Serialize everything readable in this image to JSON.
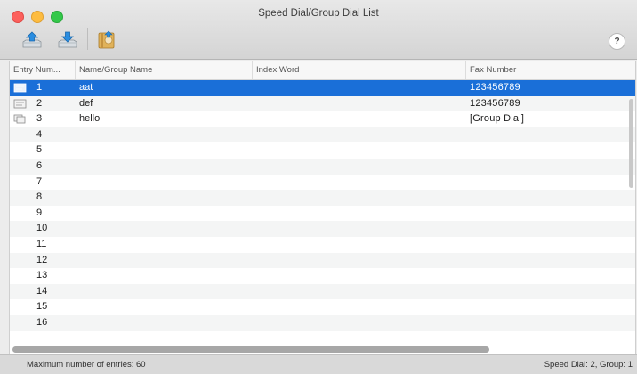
{
  "window": {
    "title": "Speed Dial/Group Dial List"
  },
  "toolbar": {
    "buttons": [
      {
        "icon": "tray-upload-icon"
      },
      {
        "icon": "tray-download-icon"
      },
      {
        "icon": "address-book-export-icon"
      }
    ],
    "help_label": "?"
  },
  "table": {
    "columns": [
      "Entry Num...",
      "Name/Group Name",
      "Index Word",
      "Fax Number"
    ],
    "rows": [
      {
        "num": "1",
        "name": "aat",
        "index": "",
        "fax": "123456789",
        "icon": "speed-dial-entry-icon",
        "selected": true
      },
      {
        "num": "2",
        "name": "def",
        "index": "",
        "fax": "123456789",
        "icon": "speed-dial-entry-icon",
        "selected": false
      },
      {
        "num": "3",
        "name": "hello",
        "index": "",
        "fax": "[Group Dial]",
        "icon": "group-dial-entry-icon",
        "selected": false
      },
      {
        "num": "4",
        "name": "",
        "index": "",
        "fax": ""
      },
      {
        "num": "5",
        "name": "",
        "index": "",
        "fax": ""
      },
      {
        "num": "6",
        "name": "",
        "index": "",
        "fax": ""
      },
      {
        "num": "7",
        "name": "",
        "index": "",
        "fax": ""
      },
      {
        "num": "8",
        "name": "",
        "index": "",
        "fax": ""
      },
      {
        "num": "9",
        "name": "",
        "index": "",
        "fax": ""
      },
      {
        "num": "10",
        "name": "",
        "index": "",
        "fax": ""
      },
      {
        "num": "11",
        "name": "",
        "index": "",
        "fax": ""
      },
      {
        "num": "12",
        "name": "",
        "index": "",
        "fax": ""
      },
      {
        "num": "13",
        "name": "",
        "index": "",
        "fax": ""
      },
      {
        "num": "14",
        "name": "",
        "index": "",
        "fax": ""
      },
      {
        "num": "15",
        "name": "",
        "index": "",
        "fax": ""
      },
      {
        "num": "16",
        "name": "",
        "index": "",
        "fax": ""
      }
    ]
  },
  "status": {
    "left": "Maximum number of entries: 60",
    "right": "Speed Dial: 2, Group: 1"
  },
  "colors": {
    "selection": "#1a6fd8"
  }
}
